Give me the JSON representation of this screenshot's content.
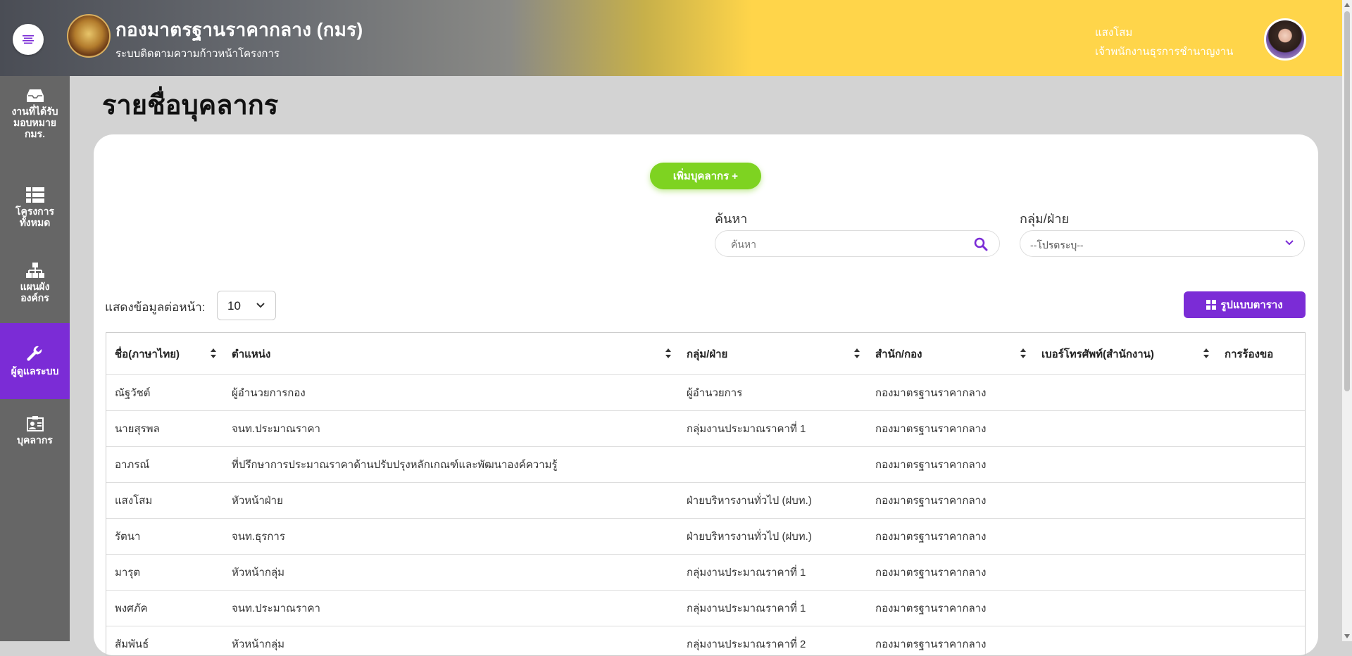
{
  "header": {
    "title": "กองมาตรฐานราคากลาง (กมร)",
    "subtitle": "ระบบติดตามความก้าวหน้าโครงการ",
    "user_name": "แสงโสม",
    "user_role": "เจ้าพนักงานธุรการชำนาญงาน",
    "menu_icon": "menu-icon",
    "logo": "department-seal-logo"
  },
  "sidebar": {
    "items": [
      {
        "label": "งานที่ได้รับมอบหมาย กมร.",
        "icon": "inbox-icon",
        "active": false
      },
      {
        "label": "โครงการทั้งหมด",
        "icon": "list-icon",
        "active": false
      },
      {
        "label": "แผนผังองค์กร",
        "icon": "org-chart-icon",
        "active": false
      },
      {
        "label": "ผู้ดูแลระบบ",
        "icon": "wrench-icon",
        "active": true
      },
      {
        "label": "บุคลากร",
        "icon": "id-card-icon",
        "active": false
      }
    ]
  },
  "page": {
    "title": "รายชื่อบุคลากร",
    "add_button": "เพิ่มบุคลากร +",
    "search_label": "ค้นหา",
    "search_placeholder": "ค้นหา",
    "group_label": "กลุ่ม/ฝ่าย",
    "group_value": "--โปรดระบุ--",
    "perpage_label": "แสดงข้อมูลต่อหน้า:",
    "perpage_value": "10",
    "grid_button": "รูปแบบตาราง"
  },
  "table": {
    "columns": [
      "ชื่อ(ภาษาไทย)",
      "ตำแหน่ง",
      "กลุ่ม/ฝ่าย",
      "สำนัก/กอง",
      "เบอร์โทรศัพท์(สำนักงาน)",
      "การร้องขอ"
    ],
    "rows": [
      [
        "ณัฐวัชต์",
        "ผู้อำนวยการกอง",
        "ผู้อำนวยการ",
        "กองมาตรฐานราคากลาง",
        "",
        ""
      ],
      [
        "นายสุรพล",
        "จนท.ประมาณราคา",
        "กลุ่มงานประมาณราคาที่ 1",
        "กองมาตรฐานราคากลาง",
        "",
        ""
      ],
      [
        "อาภรณ์",
        "ที่ปรึกษาการประมาณราคาด้านปรับปรุงหลักเกณฑ์และพัฒนาองค์ความรู้",
        "",
        "กองมาตรฐานราคากลาง",
        "",
        ""
      ],
      [
        "แสงโสม",
        "หัวหน้าฝ่าย",
        "ฝ่ายบริหารงานทั่วไป (ฝบท.)",
        "กองมาตรฐานราคากลาง",
        "",
        ""
      ],
      [
        "รัตนา",
        "จนท.ธุรการ",
        "ฝ่ายบริหารงานทั่วไป (ฝบท.)",
        "กองมาตรฐานราคากลาง",
        "",
        ""
      ],
      [
        "มารุต",
        "หัวหน้ากลุ่ม",
        "กลุ่มงานประมาณราคาที่ 1",
        "กองมาตรฐานราคากลาง",
        "",
        ""
      ],
      [
        "พงศภัค",
        "จนท.ประมาณราคา",
        "กลุ่มงานประมาณราคาที่ 1",
        "กองมาตรฐานราคากลาง",
        "",
        ""
      ],
      [
        "สัมพันธ์",
        "หัวหน้ากลุ่ม",
        "กลุ่มงานประมาณราคาที่ 2",
        "กองมาตรฐานราคากลาง",
        "",
        ""
      ]
    ]
  },
  "colors": {
    "accent_purple": "#7b2cd6",
    "add_green": "#7ed321",
    "header_yellow": "#ffd54a",
    "sidebar_gray": "#666666"
  }
}
